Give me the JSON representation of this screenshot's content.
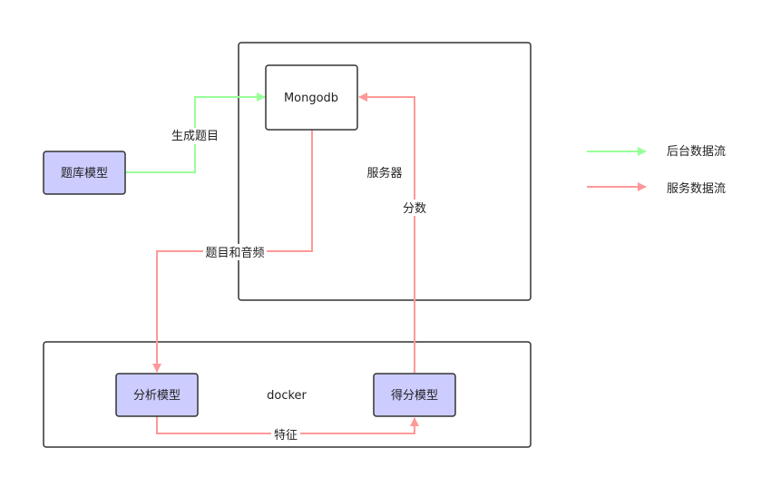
{
  "diagram": {
    "containers": {
      "server": "服务器",
      "docker": "docker"
    },
    "nodes": {
      "mongodb": "Mongodb",
      "question_bank_model": "题库模型",
      "analysis_model": "分析模型",
      "scoring_model": "得分模型"
    },
    "edges": {
      "generate_questions": "生成题目",
      "questions_and_audio": "题目和音频",
      "score": "分数",
      "features": "特征"
    },
    "legend": {
      "backend_flow": "后台数据流",
      "service_flow": "服务数据流"
    },
    "colors": {
      "backend_flow": "#99ff99",
      "service_flow": "#ff9999",
      "model_fill": "#ccccff",
      "border": "#333333"
    }
  }
}
